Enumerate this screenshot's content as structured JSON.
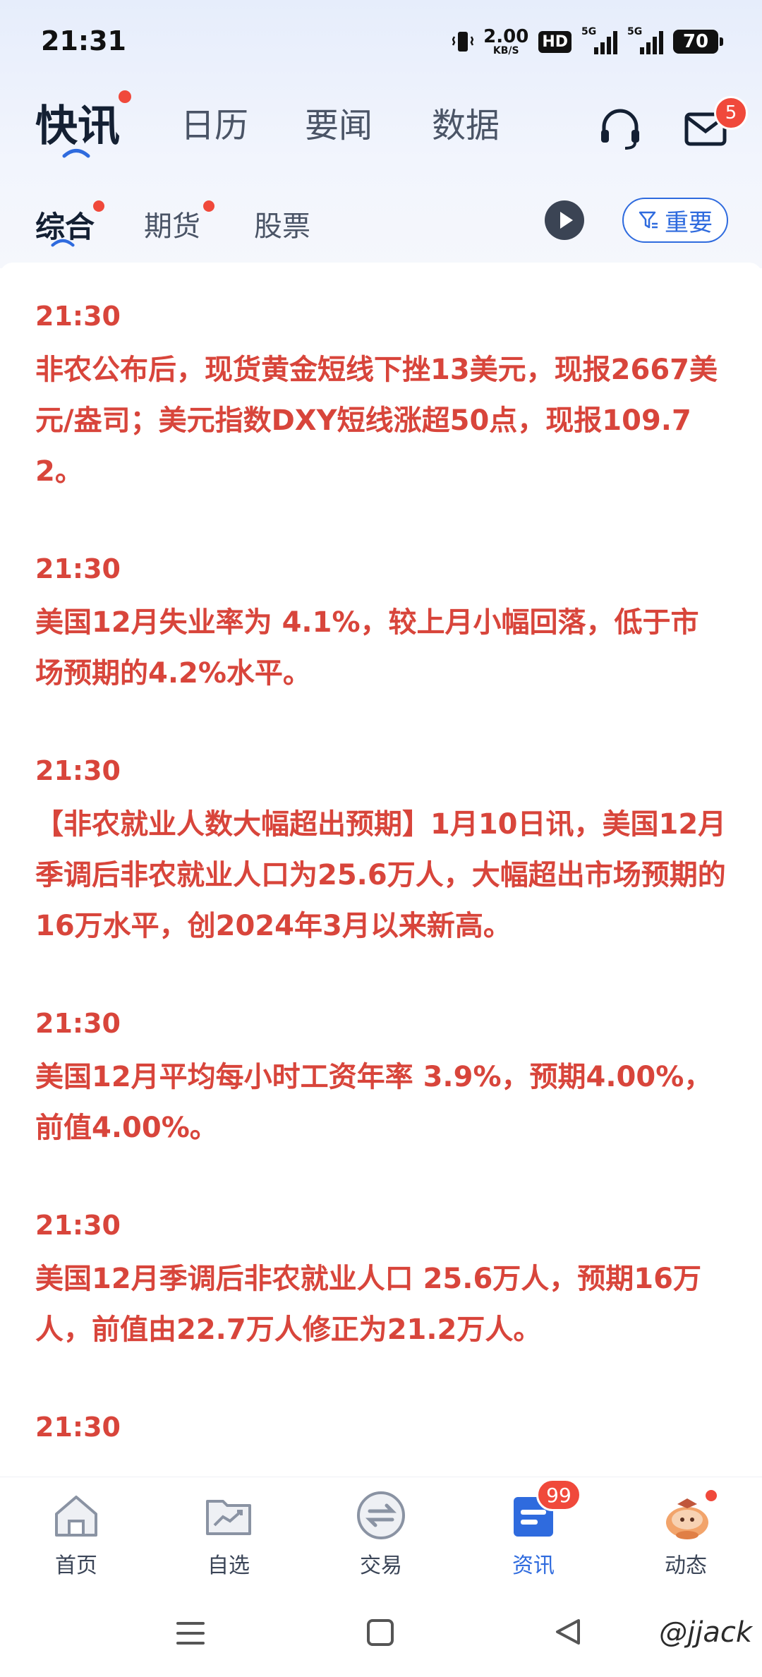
{
  "status_bar": {
    "time": "21:31",
    "net_speed": "2.00",
    "net_unit": "KB/S",
    "hd": "HD",
    "sim1_label": "5G",
    "sim2_label": "5G",
    "battery": "70"
  },
  "header": {
    "tabs": [
      {
        "label": "快讯",
        "active": true,
        "dot": true
      },
      {
        "label": "日历"
      },
      {
        "label": "要闻"
      },
      {
        "label": "数据"
      }
    ],
    "mail_badge": "5"
  },
  "subtabs": [
    {
      "label": "综合",
      "active": true,
      "dot": true
    },
    {
      "label": "期货",
      "dot": true
    },
    {
      "label": "股票"
    }
  ],
  "filter_label": "重要",
  "feed": [
    {
      "time": "21:30",
      "content": "非农公布后，现货黄金短线下挫13美元，现报2667美元/盎司；美元指数DXY短线涨超50点，现报109.72。"
    },
    {
      "time": "21:30",
      "content": "美国12月失业率为 4.1%，较上月小幅回落，低于市场预期的4.2%水平。"
    },
    {
      "time": "21:30",
      "content": "【非农就业人数大幅超出预期】1月10日讯，美国12月季调后非农就业人口为25.6万人，大幅超出市场预期的16万水平，创2024年3月以来新高。"
    },
    {
      "time": "21:30",
      "content": "美国12月平均每小时工资年率 3.9%，预期4.00%，前值4.00%。"
    },
    {
      "time": "21:30",
      "content": "美国12月季调后非农就业人口 25.6万人，预期16万人，前值由22.7万人修正为21.2万人。"
    },
    {
      "time": "21:30",
      "content": ""
    }
  ],
  "bottom_nav": [
    {
      "label": "首页",
      "icon": "home-icon"
    },
    {
      "label": "自选",
      "icon": "watchlist-icon"
    },
    {
      "label": "交易",
      "icon": "exchange-icon"
    },
    {
      "label": "资讯",
      "icon": "news-icon",
      "active": true,
      "badge": "99"
    },
    {
      "label": "动态",
      "icon": "mascot-icon"
    }
  ],
  "watermark": "@jjack",
  "colors": {
    "accent": "#2f6bde",
    "news_red": "#d8453b",
    "badge_red": "#f0493b"
  }
}
